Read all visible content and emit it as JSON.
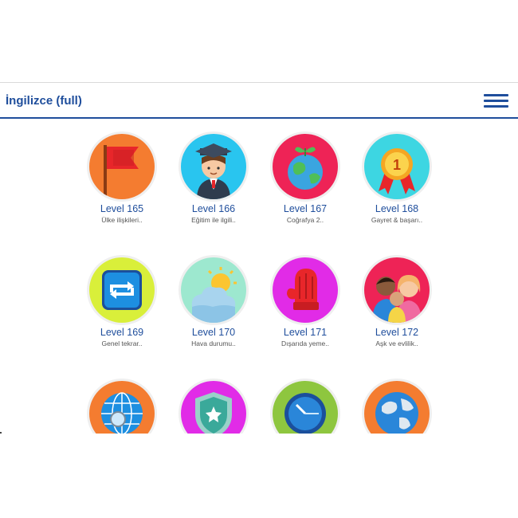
{
  "header": {
    "title": "İngilizce (full)",
    "menu_icon": "hamburger-menu-icon"
  },
  "accent_color": "#1f4e9c",
  "levels": [
    {
      "label": "Level 165",
      "subtitle": "Ülke ilişkileri..",
      "icon": "flag-icon",
      "color": "#f47c30"
    },
    {
      "label": "Level 166",
      "subtitle": "Eğitim ile ilgili..",
      "icon": "graduate-icon",
      "color": "#29c5ef"
    },
    {
      "label": "Level 167",
      "subtitle": "Coğrafya 2..",
      "icon": "earth-sprout-icon",
      "color": "#ee2356"
    },
    {
      "label": "Level 168",
      "subtitle": "Gayret & başarı..",
      "icon": "medal-icon",
      "color": "#3dd6e2"
    },
    {
      "label": "Level 169",
      "subtitle": "Genel tekrar..",
      "icon": "repeat-icon",
      "color": "#d9ef3a"
    },
    {
      "label": "Level 170",
      "subtitle": "Hava durumu..",
      "icon": "sun-cloud-icon",
      "color": "#9de8cf"
    },
    {
      "label": "Level 171",
      "subtitle": "Dışarıda yeme..",
      "icon": "oven-mitt-icon",
      "color": "#e12be7"
    },
    {
      "label": "Level 172",
      "subtitle": "Aşk ve evlilik..",
      "icon": "family-icon",
      "color": "#ee2356"
    },
    {
      "label": "",
      "subtitle": "",
      "icon": "globe-search-icon",
      "color": "#f47c30"
    },
    {
      "label": "",
      "subtitle": "",
      "icon": "shield-star-icon",
      "color": "#e12be7"
    },
    {
      "label": "",
      "subtitle": "",
      "icon": "stopwatch-icon",
      "color": "#8ec63f"
    },
    {
      "label": "",
      "subtitle": "",
      "icon": "world-map-icon",
      "color": "#f47c30"
    }
  ]
}
